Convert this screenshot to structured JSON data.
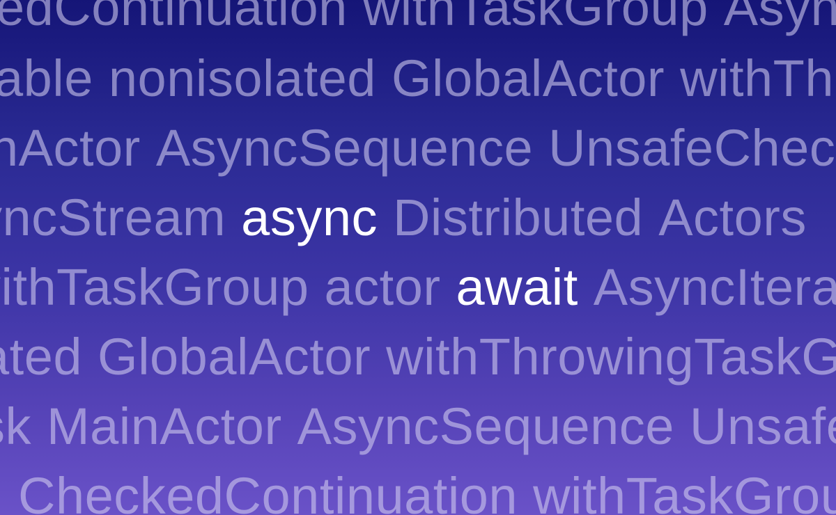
{
  "lines": [
    [
      "edContinuation",
      "withTaskGroup",
      "Async"
    ],
    [
      "able",
      "nonisolated",
      "GlobalActor",
      "withTh"
    ],
    [
      "inActor",
      "AsyncSequence",
      "UnsafeChec"
    ],
    [
      "yncStream",
      "async",
      "Distributed",
      "Actors"
    ],
    [
      "vithTaskGroup",
      "actor",
      "await",
      "AsyncItera"
    ],
    [
      "ated",
      "GlobalActor",
      "withThrowingTaskG"
    ],
    [
      "sk",
      "MainActor",
      "AsyncSequence",
      "Unsafe"
    ],
    [
      "CheckedContinuation",
      "withTaskGrou"
    ]
  ],
  "highlighted": [
    "async",
    "await"
  ],
  "colors": {
    "text": "#d2cdf0",
    "highlight": "#ffffff",
    "gradient_top": "#151577",
    "gradient_bottom": "#6a52c8"
  }
}
